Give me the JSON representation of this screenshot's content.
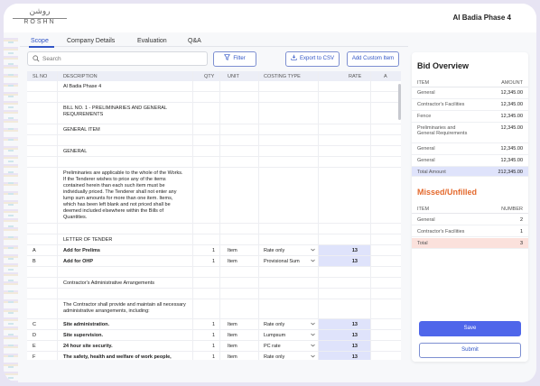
{
  "brand": {
    "logo_arabic": "روشن",
    "logo_english": "ROSHN"
  },
  "header": {
    "project_title": "Al Badia Phase 4"
  },
  "tabs": [
    {
      "label": "Scope",
      "active": true
    },
    {
      "label": "Company Details",
      "active": false
    },
    {
      "label": "Evaluation",
      "active": false
    },
    {
      "label": "Q&A",
      "active": false
    }
  ],
  "toolbar": {
    "search_placeholder": "Search",
    "filter_label": "Filter",
    "export_label": "Export to CSV",
    "add_custom_label": "Add Custom Item"
  },
  "table": {
    "columns": [
      "SL NO",
      "DESCRIPTION",
      "QTY",
      "UNIT",
      "COSTING TYPE",
      "RATE",
      "A"
    ],
    "rows": [
      {
        "sl": "",
        "desc": "Al Badia Phase 4",
        "qty": "",
        "unit": "",
        "cost": "",
        "rate": "",
        "bold": false
      },
      {
        "sl": "",
        "desc": "",
        "qty": "",
        "unit": "",
        "cost": "",
        "rate": "",
        "bold": false
      },
      {
        "sl": "",
        "desc": "BILL NO. 1 - PRELIMINARIES AND GENERAL REQUIREMENTS",
        "qty": "",
        "unit": "",
        "cost": "",
        "rate": "",
        "bold": false
      },
      {
        "sl": "",
        "desc": "GENERAL ITEM",
        "qty": "",
        "unit": "",
        "cost": "",
        "rate": "",
        "bold": false
      },
      {
        "sl": "",
        "desc": "",
        "qty": "",
        "unit": "",
        "cost": "",
        "rate": "",
        "bold": false
      },
      {
        "sl": "",
        "desc": "GENERAL",
        "qty": "",
        "unit": "",
        "cost": "",
        "rate": "",
        "bold": false
      },
      {
        "sl": "",
        "desc": "",
        "qty": "",
        "unit": "",
        "cost": "",
        "rate": "",
        "bold": false
      },
      {
        "sl": "",
        "desc": "Preliminaries are applicable to the whole of the Works. If the Tenderer wishes to price any of the items contained herein than each such item must be individually priced. The Tenderer shall not enter any lump sum amounts for more than one item. Items, which has been left blank and not priced shall be deemed included elsewhere within the Bills of Quantities.",
        "qty": "",
        "unit": "",
        "cost": "",
        "rate": "",
        "bold": false
      },
      {
        "sl": "",
        "desc": "",
        "qty": "",
        "unit": "",
        "cost": "",
        "rate": "",
        "bold": false
      },
      {
        "sl": "",
        "desc": "LETTER OF TENDER",
        "qty": "",
        "unit": "",
        "cost": "",
        "rate": "",
        "bold": false
      },
      {
        "sl": "A",
        "desc": "Add for Prelims",
        "qty": "1",
        "unit": "Item",
        "cost": "Rate only",
        "rate": "13",
        "bold": true
      },
      {
        "sl": "B",
        "desc": "Add for OHP",
        "qty": "1",
        "unit": "Item",
        "cost": "Provisional Sum",
        "rate": "13",
        "bold": true
      },
      {
        "sl": "",
        "desc": "",
        "qty": "",
        "unit": "",
        "cost": "",
        "rate": "",
        "bold": false
      },
      {
        "sl": "",
        "desc": "Contractor's Administrative Arrangements",
        "qty": "",
        "unit": "",
        "cost": "",
        "rate": "",
        "bold": false
      },
      {
        "sl": "",
        "desc": "",
        "qty": "",
        "unit": "",
        "cost": "",
        "rate": "",
        "bold": false
      },
      {
        "sl": "",
        "desc": "The Contractor shall provide and maintain all necessary administrative arrangements, including:",
        "qty": "",
        "unit": "",
        "cost": "",
        "rate": "",
        "bold": false
      },
      {
        "sl": "C",
        "desc": "Site administration.",
        "qty": "1",
        "unit": "Item",
        "cost": "Rate only",
        "rate": "13",
        "bold": true
      },
      {
        "sl": "D",
        "desc": "Site supervision.",
        "qty": "1",
        "unit": "Item",
        "cost": "Lumpsum",
        "rate": "13",
        "bold": true
      },
      {
        "sl": "E",
        "desc": "24 hour site security.",
        "qty": "1",
        "unit": "Item",
        "cost": "PC rate",
        "rate": "13",
        "bold": true
      },
      {
        "sl": "F",
        "desc": "The safety, health and welfare of work people, including provision of safety equipment for the Employer, Engineer and visitors; as required.",
        "qty": "1",
        "unit": "Item",
        "cost": "Rate only",
        "rate": "13",
        "bold": true
      }
    ]
  },
  "bid_overview": {
    "title": "Bid Overview",
    "col_item": "ITEM",
    "col_amount": "AMOUNT",
    "rows": [
      {
        "item": "General",
        "amount": "12,345.00"
      },
      {
        "item": "Contractor's Facilities",
        "amount": "12,345.00"
      },
      {
        "item": "Fence",
        "amount": "12,345.00"
      },
      {
        "item": "Preliminaries and General Requirements",
        "amount": "12,345.00"
      },
      {
        "item": "General",
        "amount": "12,345.00"
      },
      {
        "item": "General",
        "amount": "12,345.00"
      }
    ],
    "total_label": "Total Amount",
    "total_value": "212,345.00",
    "total_bg": "#dfe3fb"
  },
  "missed": {
    "title": "Missed/Unfilled",
    "title_color": "#e46a2e",
    "col_item": "ITEM",
    "col_number": "NUMBER",
    "rows": [
      {
        "item": "General",
        "number": "2"
      },
      {
        "item": "Contractor's Facilities",
        "number": "1"
      }
    ],
    "total_label": "Total",
    "total_value": "3",
    "total_bg": "#fbe1dc"
  },
  "actions": {
    "save_label": "Save",
    "submit_label": "Submit"
  },
  "colors": {
    "accent": "#3155c6",
    "primary_button": "#4f66ea"
  }
}
